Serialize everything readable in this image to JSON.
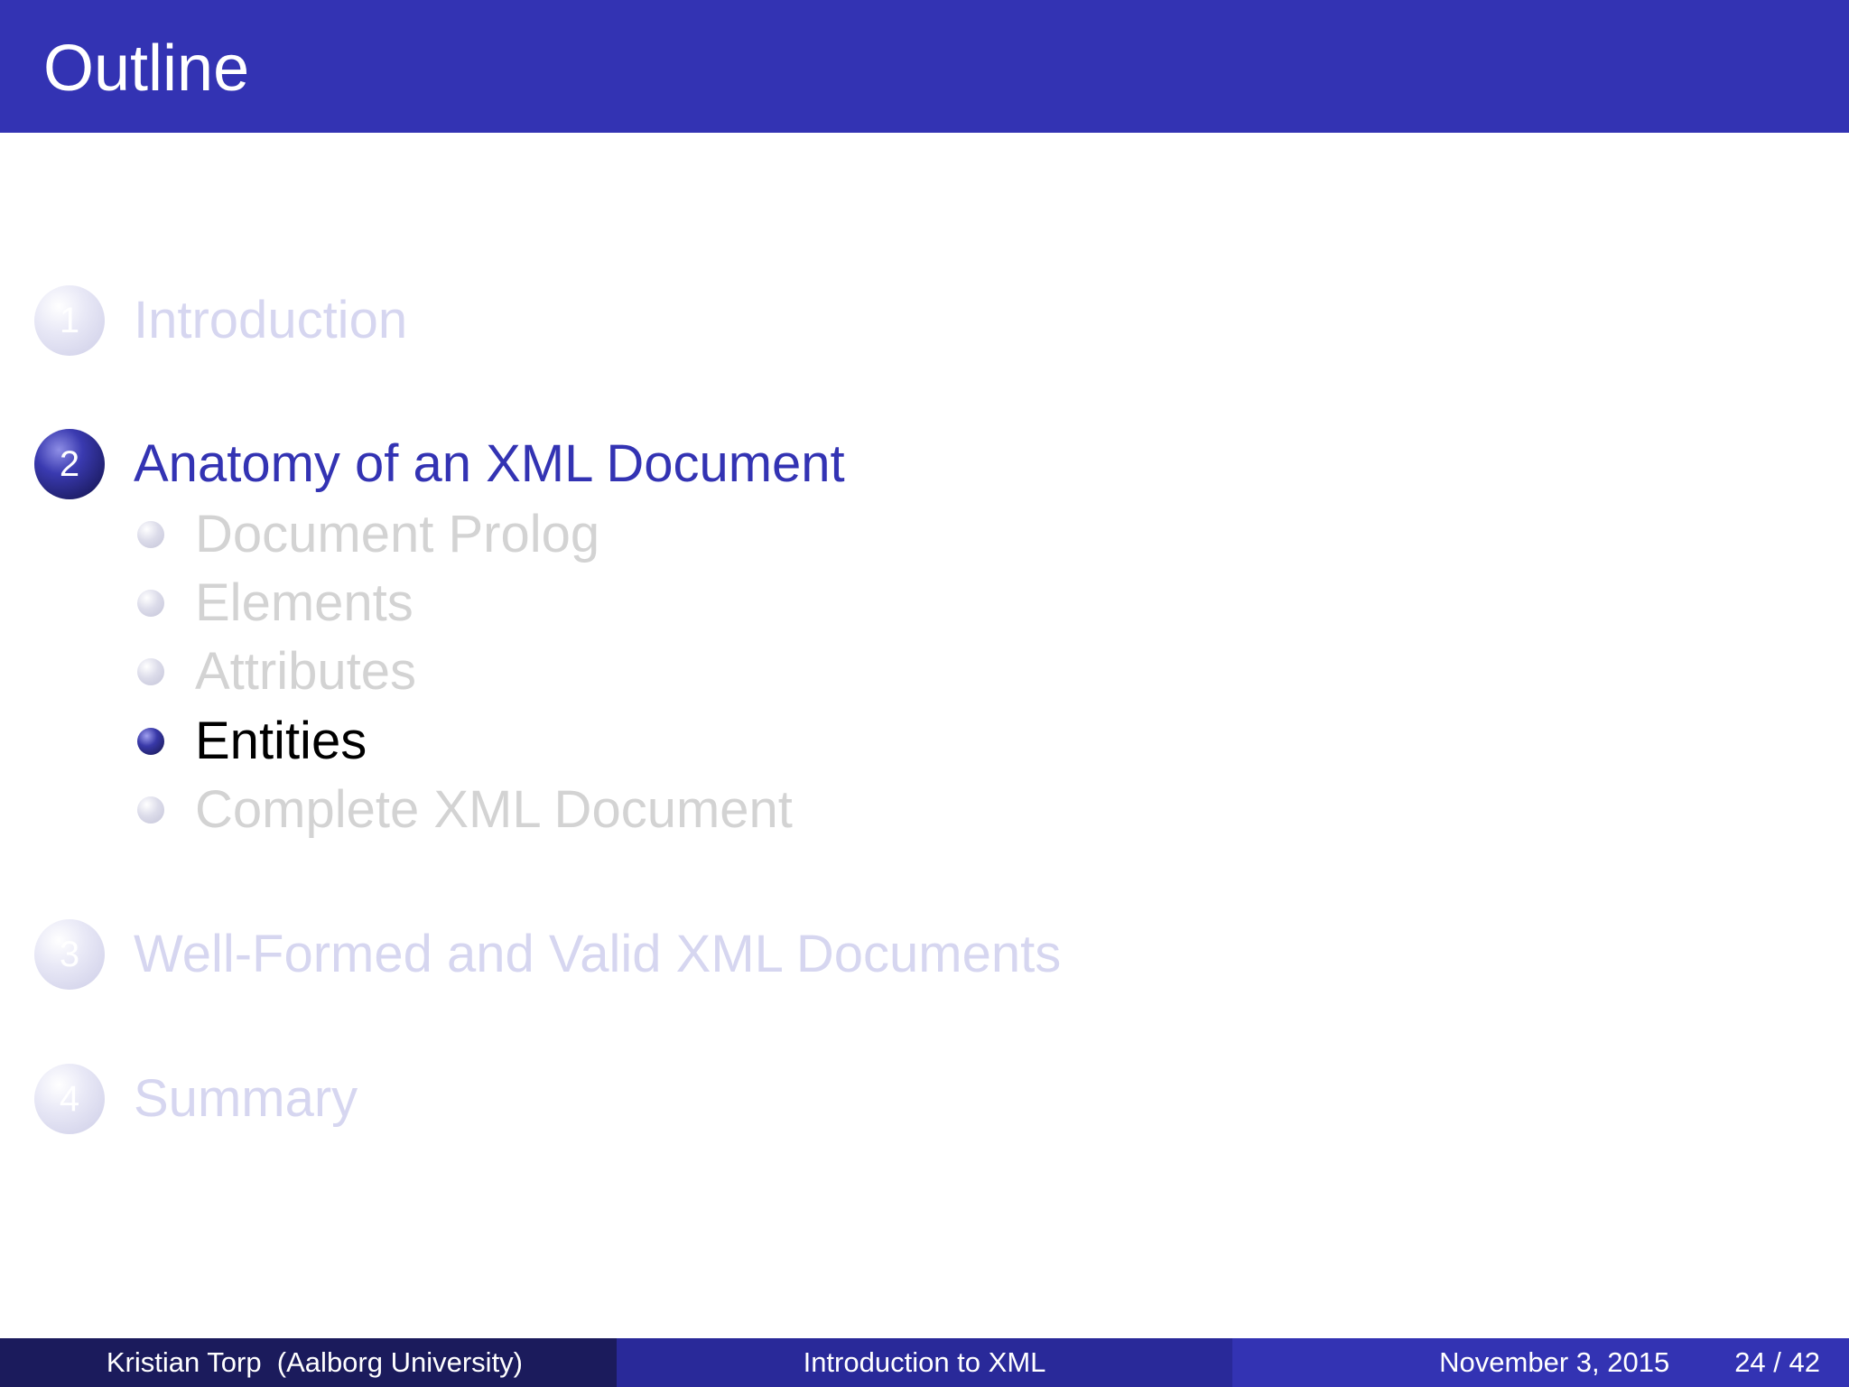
{
  "slide": {
    "title": "Outline"
  },
  "outline": {
    "sections": [
      {
        "number": "1",
        "label": "Introduction",
        "state": "dim"
      },
      {
        "number": "2",
        "label": "Anatomy of an XML Document",
        "state": "active"
      },
      {
        "number": "3",
        "label": "Well-Formed and Valid XML Documents",
        "state": "dim"
      },
      {
        "number": "4",
        "label": "Summary",
        "state": "dim"
      }
    ],
    "subsections": [
      {
        "label": "Document Prolog",
        "state": "dim"
      },
      {
        "label": "Elements",
        "state": "dim"
      },
      {
        "label": "Attributes",
        "state": "dim"
      },
      {
        "label": "Entities",
        "state": "active"
      },
      {
        "label": "Complete XML Document",
        "state": "dim"
      }
    ]
  },
  "footer": {
    "author": "Kristian Torp  (Aalborg University)",
    "presentation_title": "Introduction to XML",
    "date": "November 3, 2015",
    "page": "24 / 42"
  },
  "colors": {
    "title_bar": "#3333b3",
    "active_section": "#3333b3",
    "footer_left": "#1b1b5c",
    "footer_mid": "#292999",
    "footer_right": "#3333b3"
  }
}
